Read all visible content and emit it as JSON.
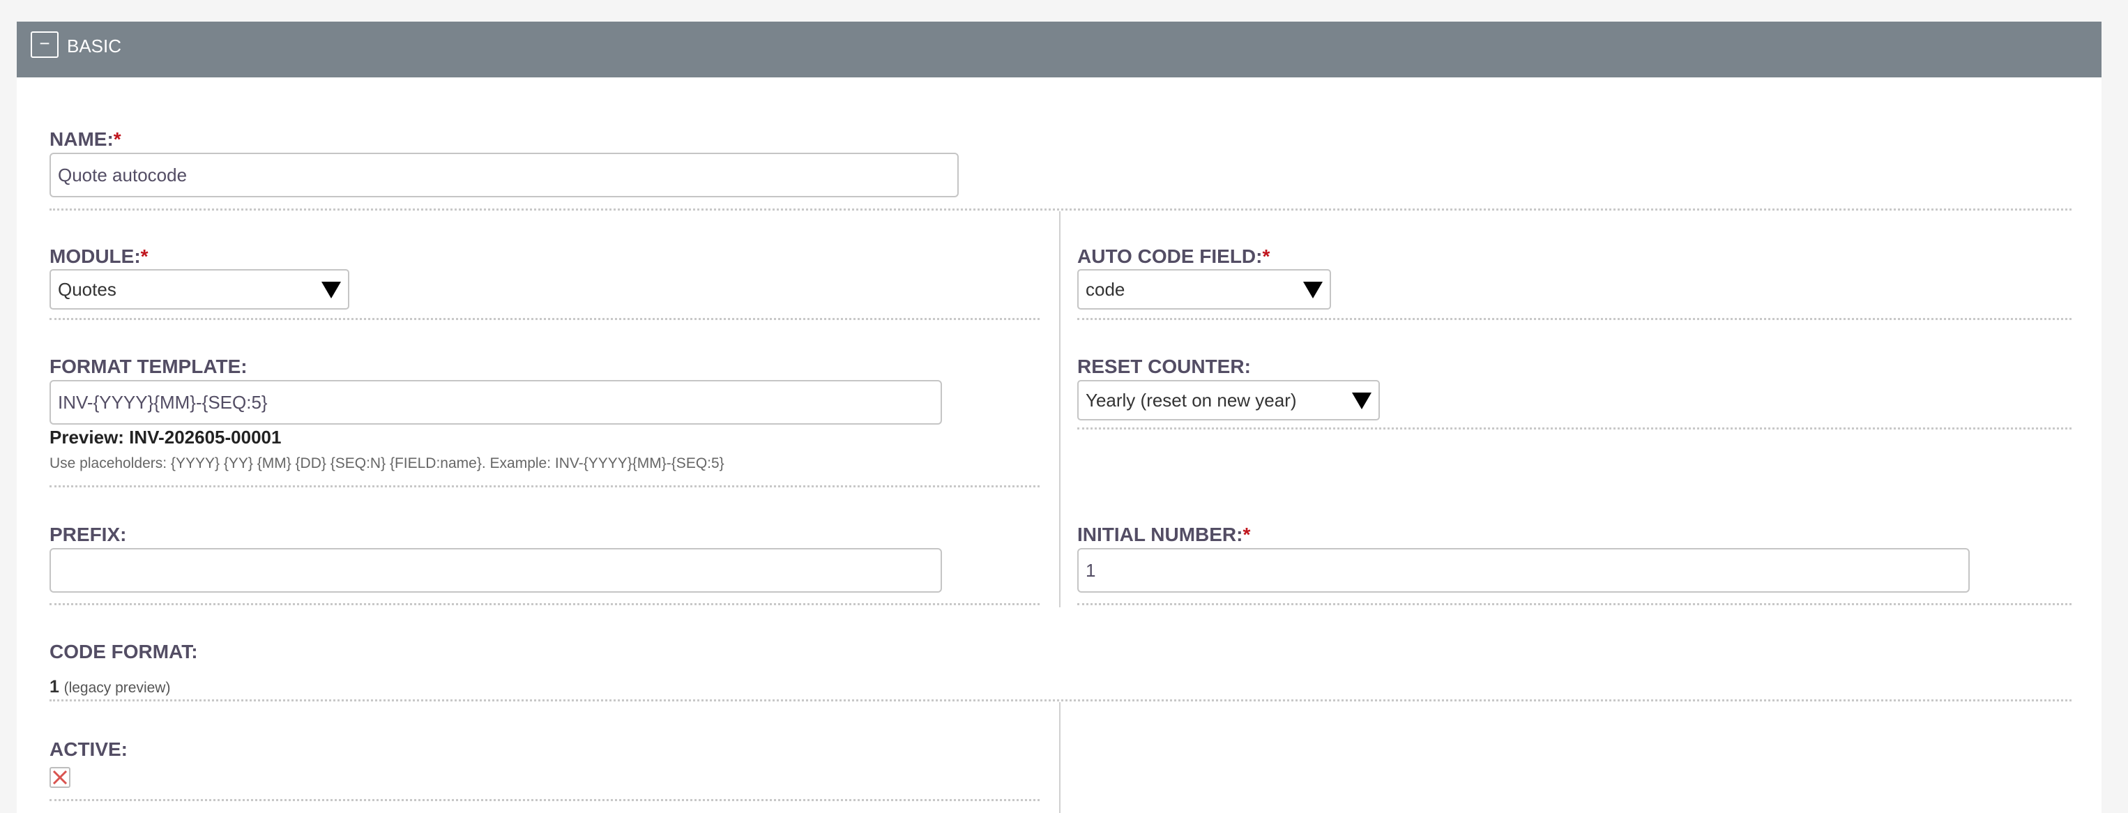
{
  "panel": {
    "collapse_symbol": "−",
    "title": "BASIC"
  },
  "fields": {
    "name": {
      "label": "NAME:",
      "required_mark": "*",
      "value": "Quote autocode"
    },
    "module": {
      "label": "MODULE:",
      "required_mark": "*",
      "value": "Quotes"
    },
    "auto_code_field": {
      "label": "AUTO CODE FIELD:",
      "required_mark": "*",
      "value": "code"
    },
    "format_template": {
      "label": "FORMAT TEMPLATE:",
      "value": "INV-{YYYY}{MM}-{SEQ:5}",
      "preview": "Preview: INV-202605-00001",
      "hint": "Use placeholders: {YYYY} {YY} {MM} {DD} {SEQ:N} {FIELD:name}. Example: INV-{YYYY}{MM}-{SEQ:5}"
    },
    "reset_counter": {
      "label": "RESET COUNTER:",
      "value": "Yearly (reset on new year)"
    },
    "prefix": {
      "label": "PREFIX:",
      "value": ""
    },
    "initial_number": {
      "label": "INITIAL NUMBER:",
      "required_mark": "*",
      "value": "1"
    },
    "code_format": {
      "label": "CODE FORMAT:",
      "value": "1",
      "note": "(legacy preview)"
    },
    "active": {
      "label": "ACTIVE:",
      "checked": false
    }
  },
  "icons": {
    "collapse": "minus-icon",
    "dropdown": "caret-down-icon",
    "checkbox": "cross-icon"
  },
  "colors": {
    "header_bg": "#7a848c",
    "required": "#c0161e",
    "label": "#534d64",
    "checkbox_cross": "#d9534f"
  }
}
